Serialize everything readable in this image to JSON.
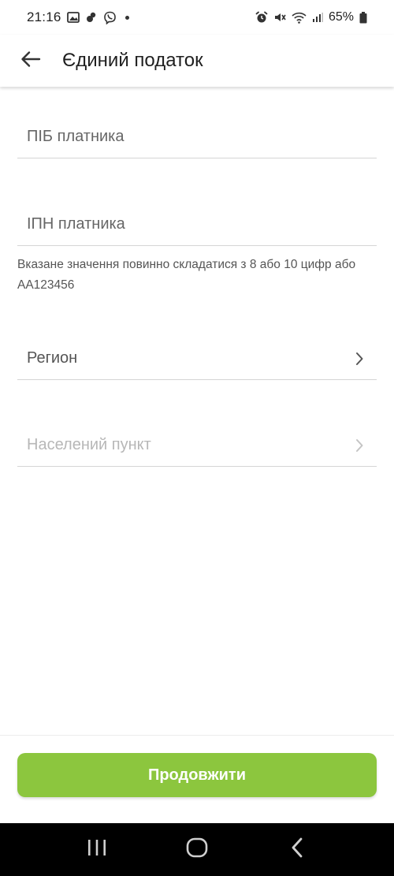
{
  "status_bar": {
    "time": "21:16",
    "battery": "65%",
    "left_icons": [
      "gallery-icon",
      "notification-icon",
      "viber-icon"
    ],
    "right_icons": [
      "alarm-icon",
      "mute-icon",
      "wifi-icon",
      "signal-icon",
      "battery-icon"
    ]
  },
  "app_bar": {
    "title": "Єдиний податок",
    "back_icon": "arrow-left-icon"
  },
  "form": {
    "payer_name": {
      "value": "",
      "placeholder": "ПІБ платника"
    },
    "payer_tax_id": {
      "value": "",
      "placeholder": "ІПН платника",
      "helper": "Вказане значення повинно складатися з 8 або 10 цифр або АА123456"
    },
    "region": {
      "label": "Регион",
      "icon": "chevron-right-icon"
    },
    "locality": {
      "label": "Населений пункт",
      "icon": "chevron-right-icon"
    }
  },
  "continue_button": {
    "label": "Продовжити",
    "color": "#8cc63e"
  },
  "nav_bar": {
    "icons": [
      "recent-apps-icon",
      "home-icon",
      "back-icon"
    ]
  }
}
